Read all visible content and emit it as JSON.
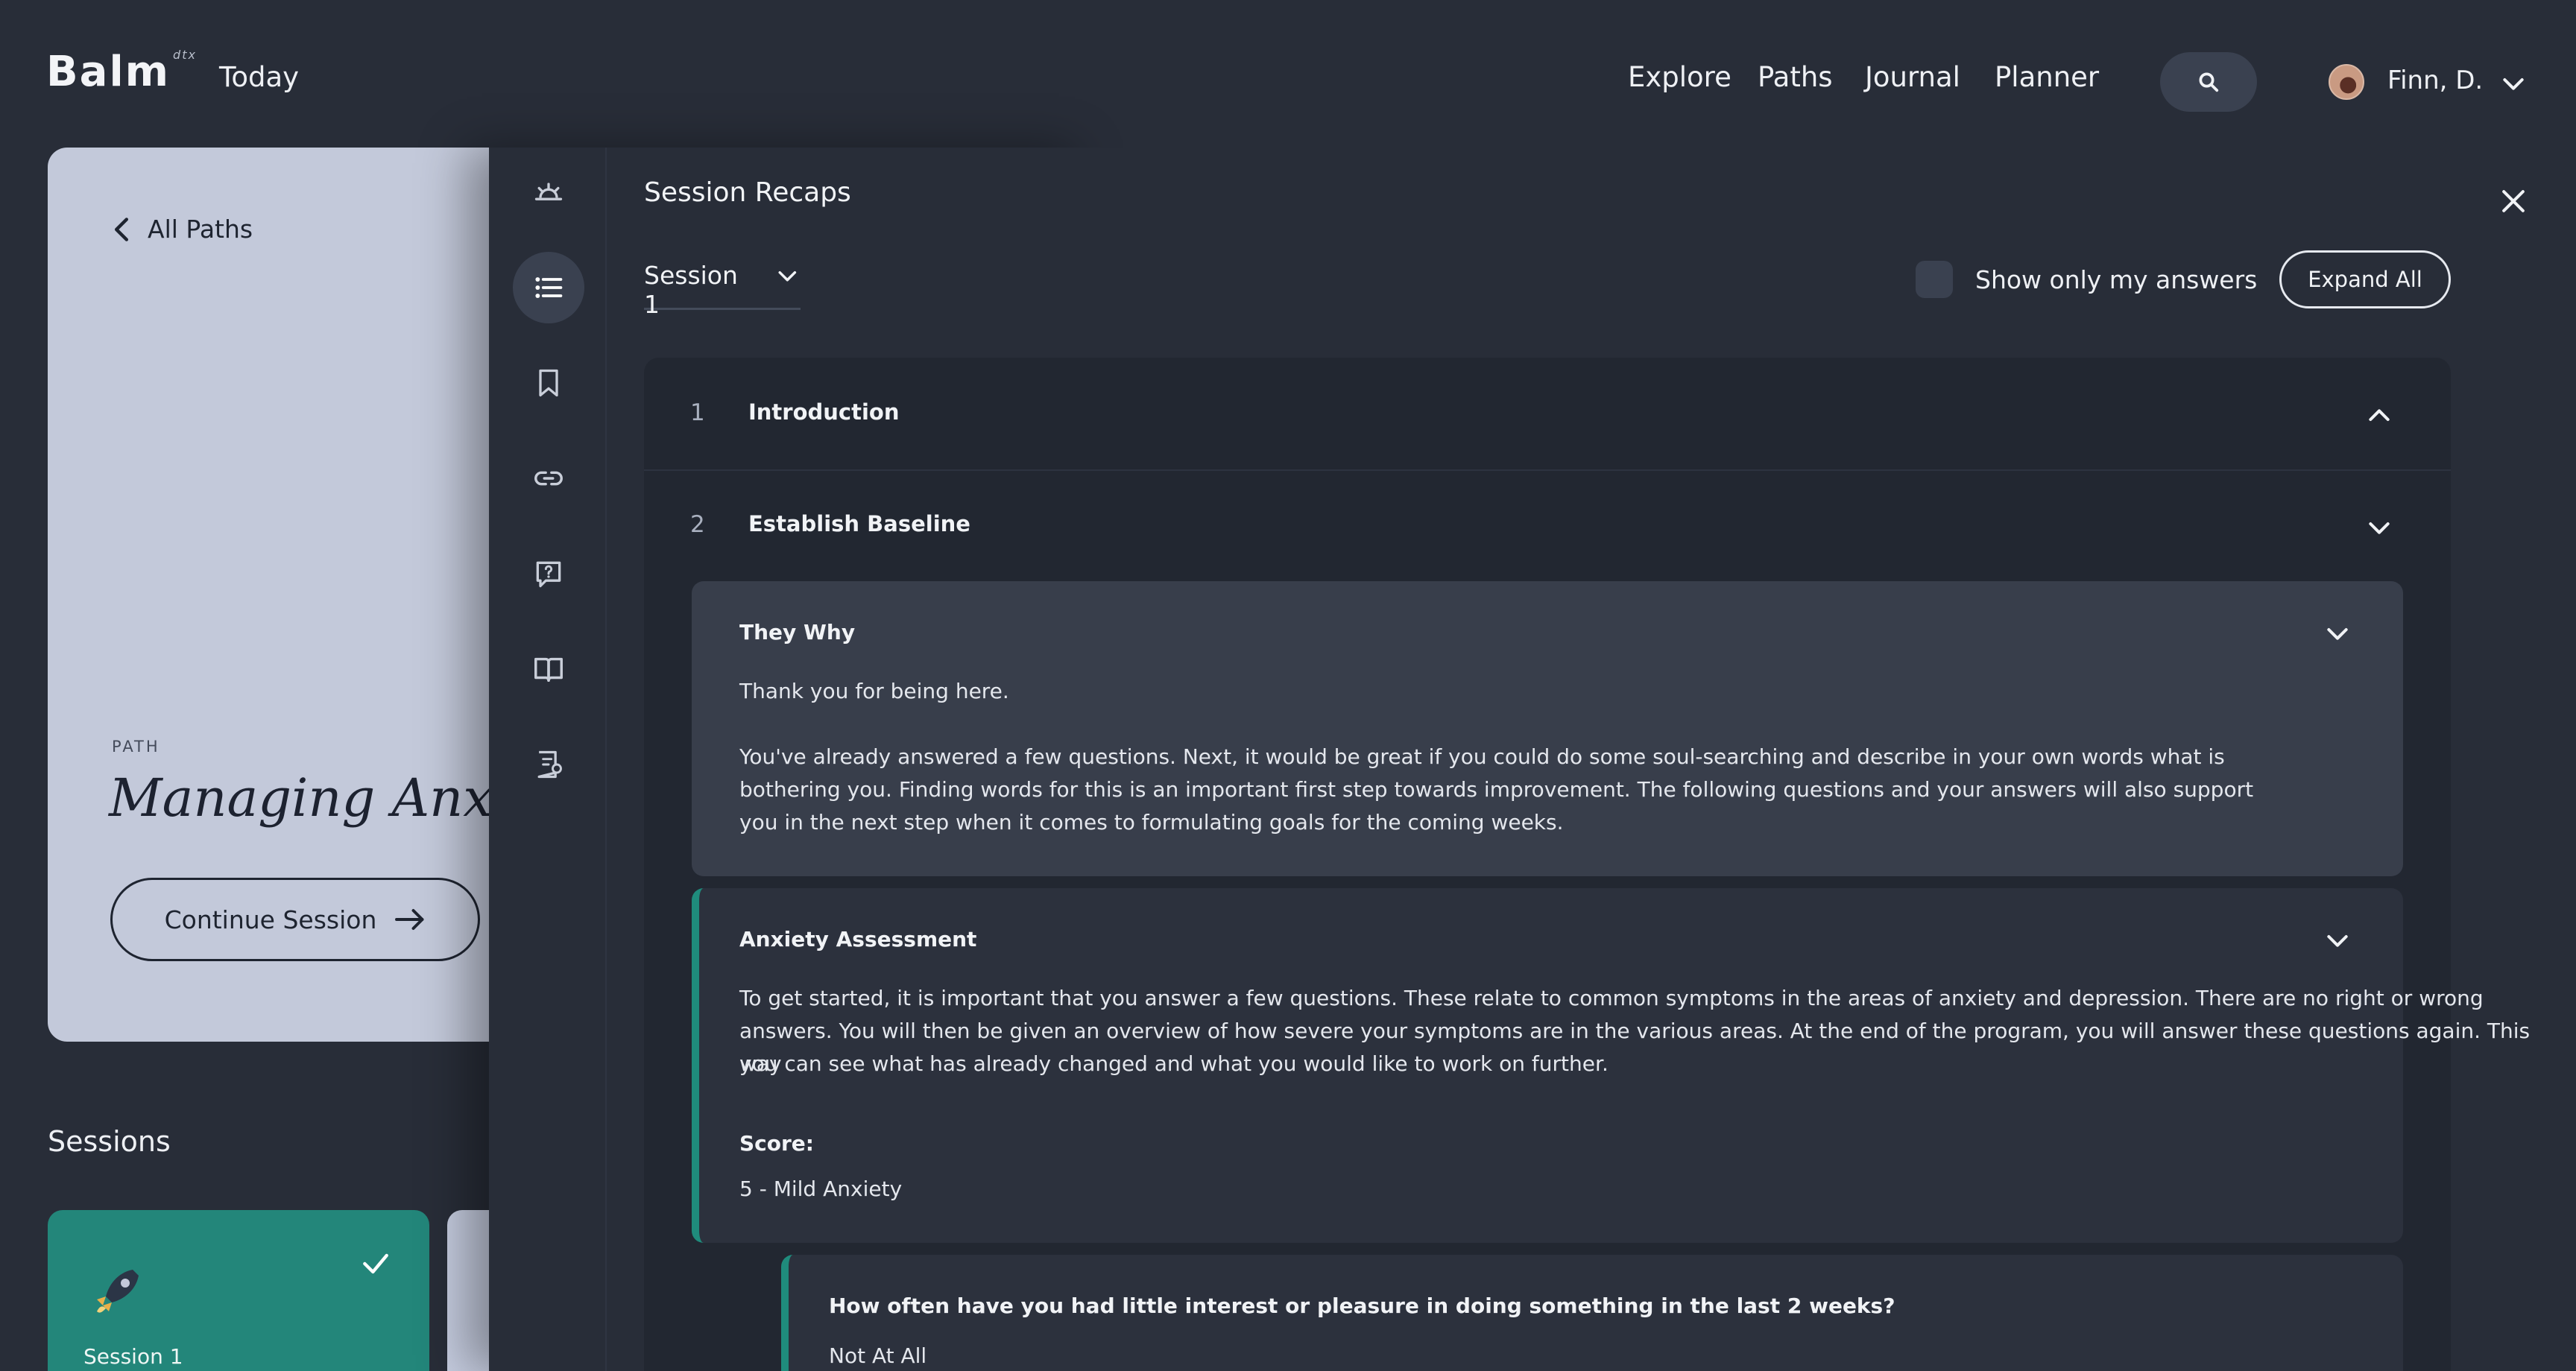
{
  "header": {
    "logo": "Balm",
    "logo_suffix": "dtx",
    "today": "Today",
    "nav": [
      "Explore",
      "Paths",
      "Journal",
      "Planner"
    ],
    "user_name": "Finn, D."
  },
  "path": {
    "back_label": "All Paths",
    "eyebrow": "PATH",
    "title": "Managing Anxiety",
    "continue_label": "Continue Session",
    "sessions_heading": "Sessions",
    "session_card_label": "Session  1"
  },
  "recaps": {
    "title": "Session Recaps",
    "session_select": "Session 1",
    "show_only_label": "Show only my answers",
    "expand_all_label": "Expand All",
    "rows": [
      {
        "num": "1",
        "title": "Introduction"
      },
      {
        "num": "2",
        "title": "Establish Baseline"
      }
    ],
    "why": {
      "title": "They Why",
      "para1": "Thank you for being here.",
      "para2_l1": "You've already answered a few questions. Next, it would be great if you could do some soul-searching and describe in your own words what is",
      "para2_l2": "bothering you. Finding words for this is an important first step towards improvement. The following questions and your answers will also support",
      "para2_l3": "you in the next step when it comes to formulating goals for the coming weeks."
    },
    "assessment": {
      "title": "Anxiety Assessment",
      "l1": "To get started, it is important that you answer a few questions. These relate to common symptoms in the areas of anxiety and depression. There are no right or wrong",
      "l2": "answers. You will then be given an overview of how severe your symptoms are in the various areas. At the end of the program, you will answer these questions again. This way",
      "l3": "you can see what has already changed and what you would like to work on further.",
      "score_label": "Score:",
      "score_value": "5 - Mild Anxiety"
    },
    "question": {
      "text": "How often have you had little interest or pleasure in doing something in the last 2 weeks?",
      "answer": "Not At All"
    }
  },
  "colors": {
    "background": "#282d38",
    "card_light": "#c3c9da",
    "accent_teal": "#1f8b7c"
  }
}
